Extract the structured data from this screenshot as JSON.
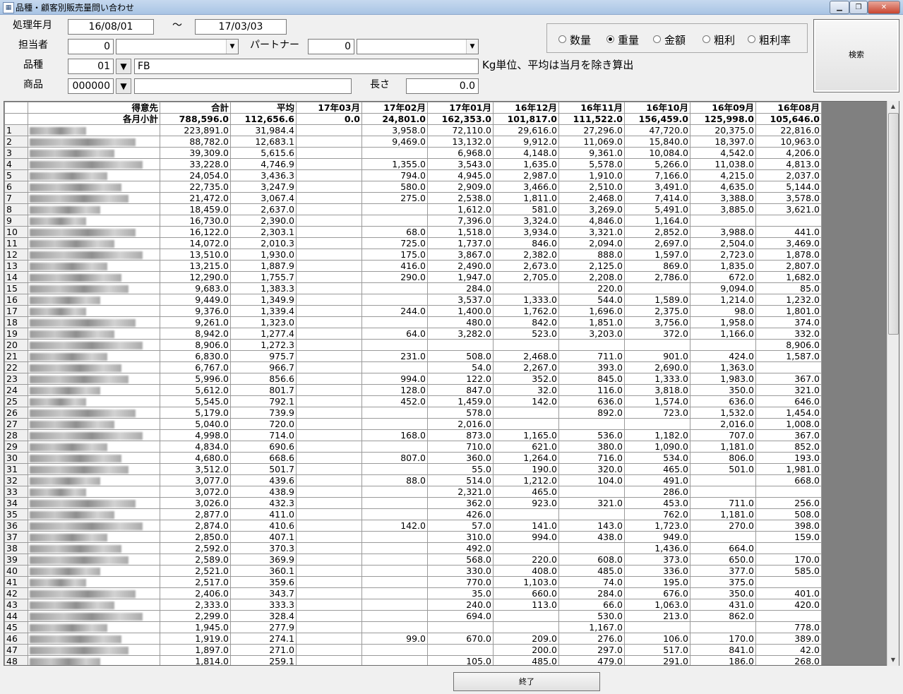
{
  "window": {
    "title": "品種・顧客別販売量問い合わせ",
    "min_icon": "minimize-icon",
    "max_icon": "maximize-icon",
    "close_icon": "close-icon"
  },
  "form": {
    "period_label": "処理年月",
    "period_from": "16/08/01",
    "period_tilde": "～",
    "period_to": "17/03/03",
    "staff_label": "担当者",
    "staff_code": "0",
    "staff_name": "",
    "partner_label": "パートナー",
    "partner_code": "0",
    "partner_name": "",
    "category_label": "品種",
    "category_code": "01",
    "category_name": "FB",
    "note": "Kg単位、平均は当月を除き算出",
    "product_label": "商品",
    "product_code": "000000",
    "product_name": "",
    "length_label": "長さ",
    "length_value": "0.0",
    "dropdown_glyph": "▼"
  },
  "radios": [
    {
      "label": "数量",
      "checked": false
    },
    {
      "label": "重量",
      "checked": true
    },
    {
      "label": "金額",
      "checked": false
    },
    {
      "label": "粗利",
      "checked": false
    },
    {
      "label": "粗利率",
      "checked": false
    }
  ],
  "search_button": "検索",
  "end_button": "終了",
  "table": {
    "headers": [
      "得意先",
      "合計",
      "平均",
      "17年03月",
      "17年02月",
      "17年01月",
      "16年12月",
      "16年11月",
      "16年10月",
      "16年09月",
      "16年08月"
    ],
    "subtotal": [
      "各月小計",
      "788,596.0",
      "112,656.6",
      "0.0",
      "24,801.0",
      "162,353.0",
      "101,817.0",
      "111,522.0",
      "156,459.0",
      "125,998.0",
      "105,646.0"
    ],
    "rows": [
      [
        "1",
        "223,891.0",
        "31,984.4",
        "",
        "3,958.0",
        "72,110.0",
        "29,616.0",
        "27,296.0",
        "47,720.0",
        "20,375.0",
        "22,816.0"
      ],
      [
        "2",
        "88,782.0",
        "12,683.1",
        "",
        "9,469.0",
        "13,132.0",
        "9,912.0",
        "11,069.0",
        "15,840.0",
        "18,397.0",
        "10,963.0"
      ],
      [
        "3",
        "39,309.0",
        "5,615.6",
        "",
        "",
        "6,968.0",
        "4,148.0",
        "9,361.0",
        "10,084.0",
        "4,542.0",
        "4,206.0"
      ],
      [
        "4",
        "33,228.0",
        "4,746.9",
        "",
        "1,355.0",
        "3,543.0",
        "1,635.0",
        "5,578.0",
        "5,266.0",
        "11,038.0",
        "4,813.0"
      ],
      [
        "5",
        "24,054.0",
        "3,436.3",
        "",
        "794.0",
        "4,945.0",
        "2,987.0",
        "1,910.0",
        "7,166.0",
        "4,215.0",
        "2,037.0"
      ],
      [
        "6",
        "22,735.0",
        "3,247.9",
        "",
        "580.0",
        "2,909.0",
        "3,466.0",
        "2,510.0",
        "3,491.0",
        "4,635.0",
        "5,144.0"
      ],
      [
        "7",
        "21,472.0",
        "3,067.4",
        "",
        "275.0",
        "2,538.0",
        "1,811.0",
        "2,468.0",
        "7,414.0",
        "3,388.0",
        "3,578.0"
      ],
      [
        "8",
        "18,459.0",
        "2,637.0",
        "",
        "",
        "1,612.0",
        "581.0",
        "3,269.0",
        "5,491.0",
        "3,885.0",
        "3,621.0"
      ],
      [
        "9",
        "16,730.0",
        "2,390.0",
        "",
        "",
        "7,396.0",
        "3,324.0",
        "4,846.0",
        "1,164.0",
        "",
        ""
      ],
      [
        "10",
        "16,122.0",
        "2,303.1",
        "",
        "68.0",
        "1,518.0",
        "3,934.0",
        "3,321.0",
        "2,852.0",
        "3,988.0",
        "441.0"
      ],
      [
        "11",
        "14,072.0",
        "2,010.3",
        "",
        "725.0",
        "1,737.0",
        "846.0",
        "2,094.0",
        "2,697.0",
        "2,504.0",
        "3,469.0"
      ],
      [
        "12",
        "13,510.0",
        "1,930.0",
        "",
        "175.0",
        "3,867.0",
        "2,382.0",
        "888.0",
        "1,597.0",
        "2,723.0",
        "1,878.0"
      ],
      [
        "13",
        "13,215.0",
        "1,887.9",
        "",
        "416.0",
        "2,490.0",
        "2,673.0",
        "2,125.0",
        "869.0",
        "1,835.0",
        "2,807.0"
      ],
      [
        "14",
        "12,290.0",
        "1,755.7",
        "",
        "290.0",
        "1,947.0",
        "2,705.0",
        "2,208.0",
        "2,786.0",
        "672.0",
        "1,682.0"
      ],
      [
        "15",
        "9,683.0",
        "1,383.3",
        "",
        "",
        "284.0",
        "",
        "220.0",
        "",
        "9,094.0",
        "85.0"
      ],
      [
        "16",
        "9,449.0",
        "1,349.9",
        "",
        "",
        "3,537.0",
        "1,333.0",
        "544.0",
        "1,589.0",
        "1,214.0",
        "1,232.0"
      ],
      [
        "17",
        "9,376.0",
        "1,339.4",
        "",
        "244.0",
        "1,400.0",
        "1,762.0",
        "1,696.0",
        "2,375.0",
        "98.0",
        "1,801.0"
      ],
      [
        "18",
        "9,261.0",
        "1,323.0",
        "",
        "",
        "480.0",
        "842.0",
        "1,851.0",
        "3,756.0",
        "1,958.0",
        "374.0"
      ],
      [
        "19",
        "8,942.0",
        "1,277.4",
        "",
        "64.0",
        "3,282.0",
        "523.0",
        "3,203.0",
        "372.0",
        "1,166.0",
        "332.0"
      ],
      [
        "20",
        "8,906.0",
        "1,272.3",
        "",
        "",
        "",
        "",
        "",
        "",
        "",
        "8,906.0"
      ],
      [
        "21",
        "6,830.0",
        "975.7",
        "",
        "231.0",
        "508.0",
        "2,468.0",
        "711.0",
        "901.0",
        "424.0",
        "1,587.0"
      ],
      [
        "22",
        "6,767.0",
        "966.7",
        "",
        "",
        "54.0",
        "2,267.0",
        "393.0",
        "2,690.0",
        "1,363.0",
        ""
      ],
      [
        "23",
        "5,996.0",
        "856.6",
        "",
        "994.0",
        "122.0",
        "352.0",
        "845.0",
        "1,333.0",
        "1,983.0",
        "367.0"
      ],
      [
        "24",
        "5,612.0",
        "801.7",
        "",
        "128.0",
        "847.0",
        "32.0",
        "116.0",
        "3,818.0",
        "350.0",
        "321.0"
      ],
      [
        "25",
        "5,545.0",
        "792.1",
        "",
        "452.0",
        "1,459.0",
        "142.0",
        "636.0",
        "1,574.0",
        "636.0",
        "646.0"
      ],
      [
        "26",
        "5,179.0",
        "739.9",
        "",
        "",
        "578.0",
        "",
        "892.0",
        "723.0",
        "1,532.0",
        "1,454.0"
      ],
      [
        "27",
        "5,040.0",
        "720.0",
        "",
        "",
        "2,016.0",
        "",
        "",
        "",
        "2,016.0",
        "1,008.0"
      ],
      [
        "28",
        "4,998.0",
        "714.0",
        "",
        "168.0",
        "873.0",
        "1,165.0",
        "536.0",
        "1,182.0",
        "707.0",
        "367.0"
      ],
      [
        "29",
        "4,834.0",
        "690.6",
        "",
        "",
        "710.0",
        "621.0",
        "380.0",
        "1,090.0",
        "1,181.0",
        "852.0"
      ],
      [
        "30",
        "4,680.0",
        "668.6",
        "",
        "807.0",
        "360.0",
        "1,264.0",
        "716.0",
        "534.0",
        "806.0",
        "193.0"
      ],
      [
        "31",
        "3,512.0",
        "501.7",
        "",
        "",
        "55.0",
        "190.0",
        "320.0",
        "465.0",
        "501.0",
        "1,981.0"
      ],
      [
        "32",
        "3,077.0",
        "439.6",
        "",
        "88.0",
        "514.0",
        "1,212.0",
        "104.0",
        "491.0",
        "",
        "668.0"
      ],
      [
        "33",
        "3,072.0",
        "438.9",
        "",
        "",
        "2,321.0",
        "465.0",
        "",
        "286.0",
        "",
        ""
      ],
      [
        "34",
        "3,026.0",
        "432.3",
        "",
        "",
        "362.0",
        "923.0",
        "321.0",
        "453.0",
        "711.0",
        "256.0"
      ],
      [
        "35",
        "2,877.0",
        "411.0",
        "",
        "",
        "426.0",
        "",
        "",
        "762.0",
        "1,181.0",
        "508.0"
      ],
      [
        "36",
        "2,874.0",
        "410.6",
        "",
        "142.0",
        "57.0",
        "141.0",
        "143.0",
        "1,723.0",
        "270.0",
        "398.0"
      ],
      [
        "37",
        "2,850.0",
        "407.1",
        "",
        "",
        "310.0",
        "994.0",
        "438.0",
        "949.0",
        "",
        "159.0"
      ],
      [
        "38",
        "2,592.0",
        "370.3",
        "",
        "",
        "492.0",
        "",
        "",
        "1,436.0",
        "664.0",
        ""
      ],
      [
        "39",
        "2,589.0",
        "369.9",
        "",
        "",
        "568.0",
        "220.0",
        "608.0",
        "373.0",
        "650.0",
        "170.0"
      ],
      [
        "40",
        "2,521.0",
        "360.1",
        "",
        "",
        "330.0",
        "408.0",
        "485.0",
        "336.0",
        "377.0",
        "585.0"
      ],
      [
        "41",
        "2,517.0",
        "359.6",
        "",
        "",
        "770.0",
        "1,103.0",
        "74.0",
        "195.0",
        "375.0",
        ""
      ],
      [
        "42",
        "2,406.0",
        "343.7",
        "",
        "",
        "35.0",
        "660.0",
        "284.0",
        "676.0",
        "350.0",
        "401.0"
      ],
      [
        "43",
        "2,333.0",
        "333.3",
        "",
        "",
        "240.0",
        "113.0",
        "66.0",
        "1,063.0",
        "431.0",
        "420.0"
      ],
      [
        "44",
        "2,299.0",
        "328.4",
        "",
        "",
        "694.0",
        "",
        "530.0",
        "213.0",
        "862.0",
        ""
      ],
      [
        "45",
        "1,945.0",
        "277.9",
        "",
        "",
        "",
        "",
        "1,167.0",
        "",
        "",
        "778.0"
      ],
      [
        "46",
        "1,919.0",
        "274.1",
        "",
        "99.0",
        "670.0",
        "209.0",
        "276.0",
        "106.0",
        "170.0",
        "389.0"
      ],
      [
        "47",
        "1,897.0",
        "271.0",
        "",
        "",
        "",
        "200.0",
        "297.0",
        "517.0",
        "841.0",
        "42.0"
      ],
      [
        "48",
        "1,814.0",
        "259.1",
        "",
        "",
        "105.0",
        "485.0",
        "479.0",
        "291.0",
        "186.0",
        "268.0"
      ]
    ]
  }
}
